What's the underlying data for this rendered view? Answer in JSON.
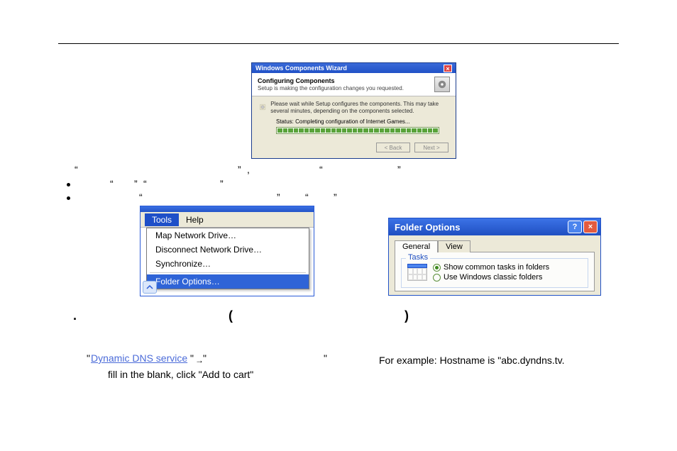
{
  "wizard": {
    "title": "Windows Components Wizard",
    "heading": "Configuring Components",
    "subheading": "Setup is making the configuration changes you requested.",
    "desc": "Please wait while Setup configures the components. This may take several minutes, depending on the components selected.",
    "status_label": "Status:",
    "status_value": "Completing configuration of Internet Games...",
    "back_label": "< Back",
    "next_label": "Next >"
  },
  "tools_menu": {
    "tools_label": "Tools",
    "help_label": "Help",
    "items": [
      "Map Network Drive…",
      "Disconnect Network Drive…",
      "Synchronize…"
    ],
    "selected_item": "Folder Options…"
  },
  "folder_options": {
    "title": "Folder Options",
    "tab_general": "General",
    "tab_view": "View",
    "legend": "Tasks",
    "radio1": "Show common tasks in folders",
    "radio2": "Use Windows classic folders"
  },
  "text": {
    "dns_link": "Dynamic DNS service",
    "fill_line": "fill in the blank, click \"Add to cart\"",
    "example_line": "For example: Hostname is \"abc.dyndns.tv."
  }
}
